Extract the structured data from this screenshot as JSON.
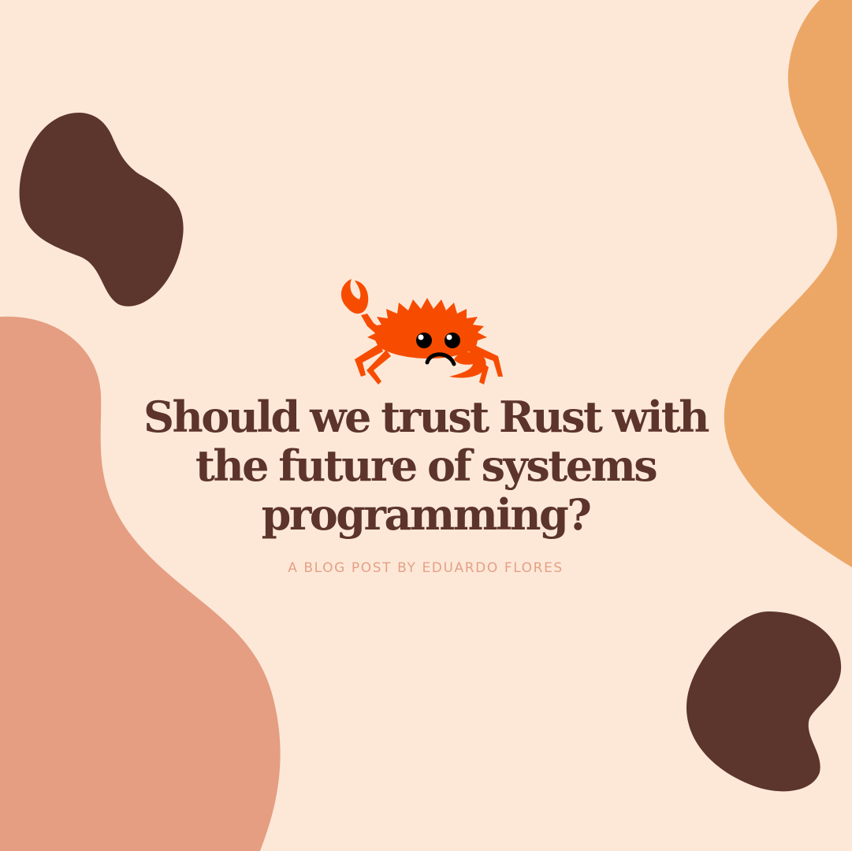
{
  "title": {
    "line1": "Should we trust Rust with",
    "line2": "the future of systems",
    "line3": "programming?"
  },
  "byline": "A BLOG POST BY EDUARDO FLORES",
  "colors": {
    "background": "#fde8d8",
    "blob_dark_brown": "#5c352d",
    "blob_salmon": "#e59e82",
    "blob_orange": "#eca766",
    "title_text": "#5c342b",
    "byline_text": "#e4a085",
    "crab_orange": "#f74c00"
  },
  "icons": {
    "mascot": "ferris-crab-icon"
  }
}
